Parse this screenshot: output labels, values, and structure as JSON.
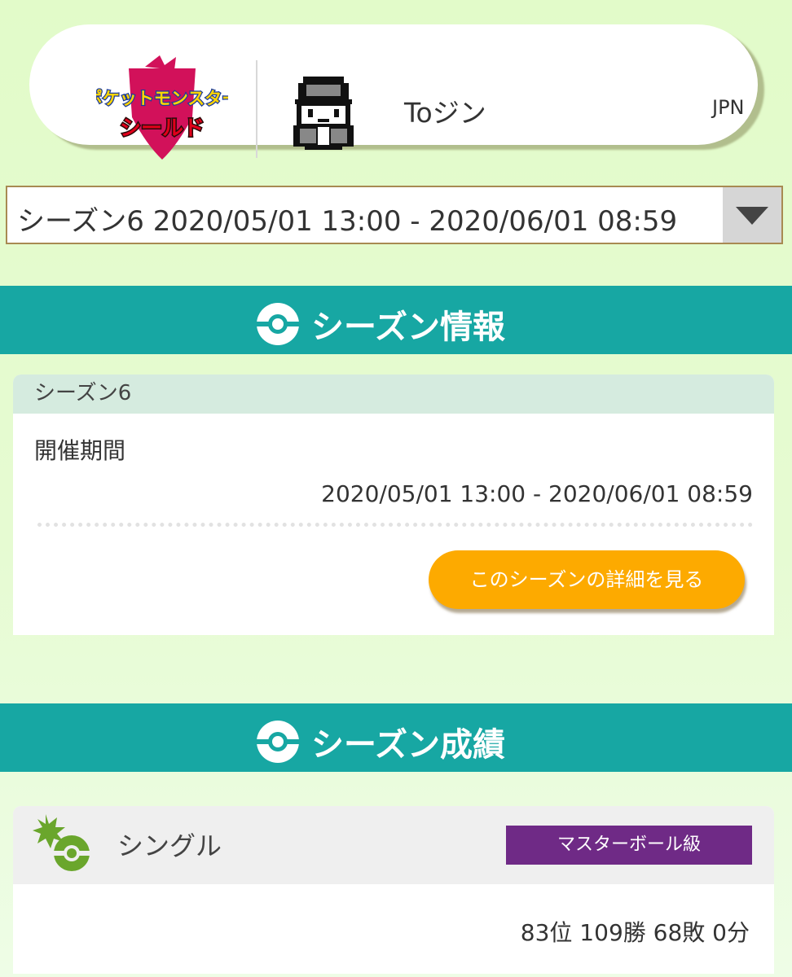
{
  "profile": {
    "game_logo_text_top": "ポケットモンスター",
    "game_logo_text_bottom": "シールド",
    "trainer_name": "Toジン",
    "region": "JPN"
  },
  "season_select": {
    "selected": "シーズン6 2020/05/01 13:00 - 2020/06/01 08:59"
  },
  "season_info": {
    "banner_title": "シーズン情報",
    "card_title": "シーズン6",
    "period_label": "開催期間",
    "period_value": "2020/05/01 13:00 - 2020/06/01 08:59",
    "details_button": "このシーズンの詳細を見る"
  },
  "season_results": {
    "banner_title": "シーズン成績",
    "battle_type": "シングル",
    "rank_class": "マスターボール級",
    "stats": "83位 109勝 68敗 0分"
  },
  "colors": {
    "banner": "#17a7a3",
    "button": "#fdaa00",
    "rank_badge": "#6f2a86"
  },
  "icons": [
    "game-logo",
    "trainer-sprite",
    "pokeball-icon",
    "dropdown-arrow-icon",
    "single-battle-icon"
  ]
}
